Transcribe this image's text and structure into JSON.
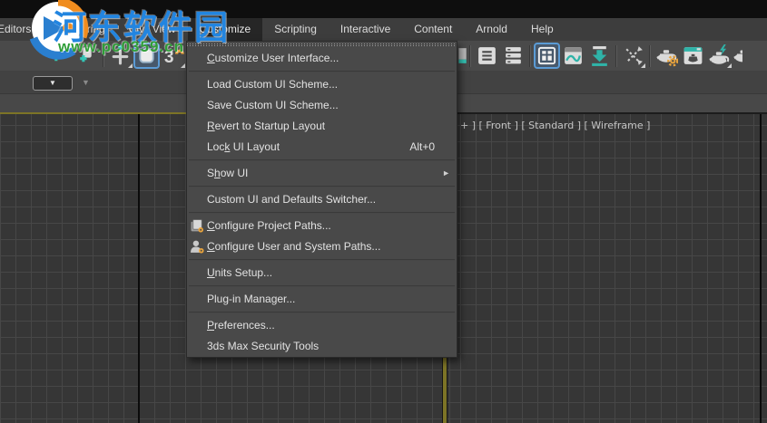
{
  "watermarks": {
    "site_name_cn": "河东软件园",
    "site_url": "www.pc0359.cn",
    "logo_blue": "#2a7fd0",
    "logo_orange": "#f08c1e"
  },
  "menubar": {
    "items": [
      {
        "label": "Editors",
        "active": false
      },
      {
        "label": "Rendering",
        "active": false
      },
      {
        "label": "Civil View",
        "active": false
      },
      {
        "label": "Customize",
        "active": true
      },
      {
        "label": "Scripting",
        "active": false
      },
      {
        "label": "Interactive",
        "active": false
      },
      {
        "label": "Content",
        "active": false
      },
      {
        "label": "Arnold",
        "active": false
      },
      {
        "label": "Help",
        "active": false
      }
    ]
  },
  "toolbar": {
    "left_icons": [
      {
        "icon": "select-link-icon"
      },
      {
        "icon": "unlink-icon"
      },
      {
        "type": "divider"
      },
      {
        "icon": "select-place-icon",
        "flyout": true
      },
      {
        "icon": "select-object-icon",
        "active": true
      },
      {
        "icon": "snaps-toggle-icon",
        "flyout": true
      },
      {
        "icon": "partial-bracket-icon"
      }
    ],
    "right_icons": [
      {
        "icon": "sliver-icon",
        "narrow": true
      },
      {
        "type": "divider"
      },
      {
        "icon": "scene-explorer-icon"
      },
      {
        "icon": "layer-explorer-icon"
      },
      {
        "type": "divider"
      },
      {
        "icon": "ribbon-toggle-icon",
        "active": true
      },
      {
        "icon": "curve-editor-icon"
      },
      {
        "icon": "import-arrow-icon"
      },
      {
        "type": "divider"
      },
      {
        "icon": "schematic-view-icon",
        "flyout": true
      },
      {
        "type": "divider"
      },
      {
        "icon": "render-setup-icon"
      },
      {
        "icon": "rendered-frame-window-icon"
      },
      {
        "icon": "render-production-icon",
        "flyout": true
      },
      {
        "icon": "render-partial-icon",
        "narrow": true
      }
    ]
  },
  "quick_access_row": {
    "viewport_dropdown_glyph": "▼",
    "chevron_glyph": "▼"
  },
  "menu": {
    "title": "Customize",
    "items": [
      {
        "pre": "",
        "key": "C",
        "post": "ustomize User Interface...",
        "sep_after": true
      },
      {
        "pre": "Load Custom UI Scheme...",
        "key": "",
        "post": ""
      },
      {
        "pre": "Save Custom UI Scheme...",
        "key": "",
        "post": ""
      },
      {
        "pre": "",
        "key": "R",
        "post": "evert to Startup Layout"
      },
      {
        "pre": "Loc",
        "key": "k",
        "post": " UI Layout",
        "shortcut": "Alt+0",
        "sep_after": true
      },
      {
        "pre": "S",
        "key": "h",
        "post": "ow UI",
        "submenu": true,
        "sep_after": true
      },
      {
        "pre": "Custom UI and Defaults Switcher...",
        "key": "",
        "post": "",
        "sep_after": true
      },
      {
        "icon": "project-paths-icon",
        "pre": "",
        "key": "C",
        "post": "onfigure Project Paths..."
      },
      {
        "icon": "user-paths-icon",
        "pre": "",
        "key": "C",
        "post": "onfigure User and System Paths...",
        "sep_after": true
      },
      {
        "pre": "",
        "key": "U",
        "post": "nits Setup...",
        "sep_after": true
      },
      {
        "pre": "Plug-in Manager...",
        "key": "",
        "post": "",
        "sep_after": true
      },
      {
        "pre": "",
        "key": "P",
        "post": "references..."
      },
      {
        "pre": "3ds Max Security Tools",
        "key": "",
        "post": ""
      }
    ],
    "submenu_arrow_glyph": "►"
  },
  "viewport": {
    "label": "+ ]  [ Front ]  [ Standard ]  [ Wireframe ]",
    "active_border_color": "#7d7426",
    "grid_background": "#363636",
    "grid_line_color": "#474747",
    "axis_line_color": "#0b0b0b"
  }
}
